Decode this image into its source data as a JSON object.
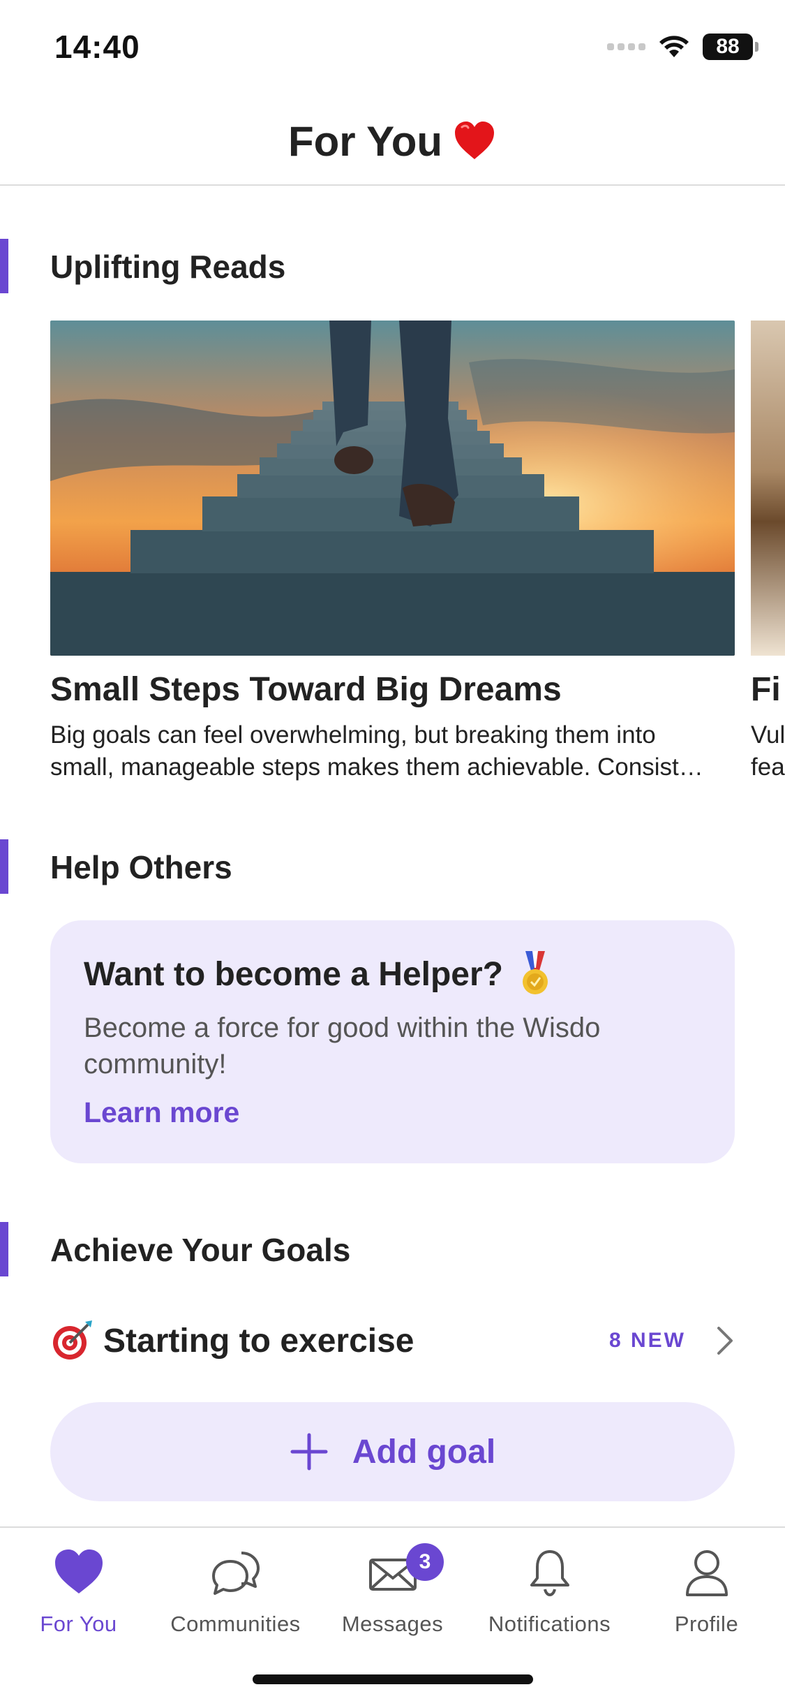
{
  "status_bar": {
    "time": "14:40",
    "battery": "88"
  },
  "header": {
    "title": "For You",
    "emoji_icon": "red-heart-icon"
  },
  "sections": {
    "uplifting_reads": "Uplifting Reads",
    "help_others": "Help Others",
    "achieve_goals": "Achieve Your Goals"
  },
  "articles": [
    {
      "title": "Small Steps Toward Big Dreams",
      "text_line1": "Big goals can feel overwhelming, but breaking them into",
      "text_line2": "small, manageable steps makes them achievable. Consist…"
    },
    {
      "title": "Fi",
      "text_line1": "Vul",
      "text_line2": "fea"
    }
  ],
  "helper_card": {
    "title": "Want to become a Helper?",
    "description": "Become a force for good within the Wisdo community!",
    "link": "Learn more",
    "icon": "medal-icon"
  },
  "goals": [
    {
      "label": "Starting to exercise",
      "new_badge": "8 NEW",
      "icon": "target-dart-icon"
    }
  ],
  "add_goal": {
    "label": "Add goal"
  },
  "tabs": [
    {
      "label": "For You",
      "icon": "heart-icon",
      "active": true
    },
    {
      "label": "Communities",
      "icon": "chat-bubbles-icon",
      "active": false
    },
    {
      "label": "Messages",
      "icon": "envelope-icon",
      "active": false,
      "badge": "3"
    },
    {
      "label": "Notifications",
      "icon": "bell-icon",
      "active": false
    },
    {
      "label": "Profile",
      "icon": "person-icon",
      "active": false
    }
  ],
  "colors": {
    "accent": "#6a47d1",
    "card_background": "#eeeafc",
    "text": "#222222"
  }
}
